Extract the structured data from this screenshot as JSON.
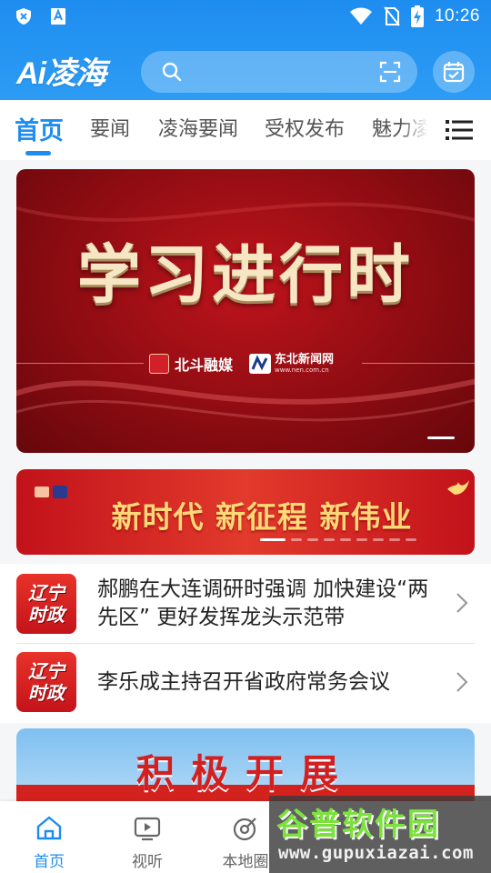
{
  "status_bar": {
    "time": "10:26",
    "left_icons": [
      "shield-x-icon",
      "a-box-icon"
    ],
    "right_icons": [
      "wifi-icon",
      "no-sim-icon",
      "battery-charging-icon"
    ]
  },
  "header": {
    "logo_text": "Ai凌海",
    "search_placeholder": "",
    "colors": {
      "primary": "#1e8df0"
    }
  },
  "tabs": [
    {
      "label": "首页",
      "active": true
    },
    {
      "label": "要闻",
      "active": false
    },
    {
      "label": "凌海要闻",
      "active": false
    },
    {
      "label": "受权发布",
      "active": false
    },
    {
      "label": "魅力凌",
      "active": false
    }
  ],
  "banner": {
    "title": "学习进行时",
    "logo1": "北斗融媒",
    "logo2": "东北新闻网",
    "logo2_url": "www.nen.com.cn"
  },
  "slogan": {
    "text": "新时代 新征程 新伟业"
  },
  "news": [
    {
      "thumb_text": "辽宁 时政",
      "title": "郝鹏在大连调研时强调 加快建设“两先区” 更好发挥龙头示范带"
    },
    {
      "thumb_text": "辽宁 时政",
      "title": "李乐成主持召开省政府常务会议"
    }
  ],
  "feature_card": {
    "text": "积极开展"
  },
  "bottom_nav": [
    {
      "label": "首页",
      "icon": "home-icon",
      "active": true
    },
    {
      "label": "视听",
      "icon": "tv-play-icon",
      "active": false
    },
    {
      "label": "本地圈",
      "icon": "local-circle-icon",
      "active": false
    }
  ],
  "watermark": {
    "title": "谷普软件园",
    "url": "www.gupuxiazai.com"
  }
}
